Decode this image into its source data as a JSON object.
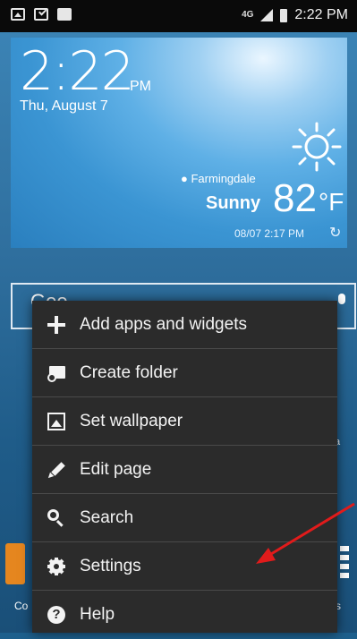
{
  "status_bar": {
    "time": "2:22 PM",
    "network": "4G"
  },
  "widget": {
    "clock": "2:22",
    "ampm": "PM",
    "date": "Thu, August 7",
    "location": "Farmingdale",
    "condition": "Sunny",
    "temperature": "82",
    "unit": "°F",
    "updated": "08/07 2:17 PM"
  },
  "search_bar": {
    "text": "Goo"
  },
  "dock": {
    "left_label": "Co",
    "right_label": "s"
  },
  "menu": {
    "items": [
      {
        "label": "Add apps and widgets",
        "icon": "plus-icon"
      },
      {
        "label": "Create folder",
        "icon": "folder-icon"
      },
      {
        "label": "Set wallpaper",
        "icon": "wallpaper-icon"
      },
      {
        "label": "Edit page",
        "icon": "pencil-icon"
      },
      {
        "label": "Search",
        "icon": "search-icon"
      },
      {
        "label": "Settings",
        "icon": "gear-icon"
      },
      {
        "label": "Help",
        "icon": "help-icon"
      }
    ]
  },
  "colors": {
    "menu_bg": "#2b2b2b",
    "divider": "#4a4a4a",
    "arrow": "#e11b1b"
  }
}
